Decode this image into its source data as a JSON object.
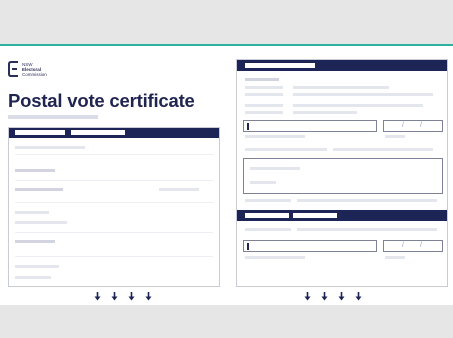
{
  "document": {
    "logo": {
      "lines": [
        "NSW",
        "Electoral",
        "Commission"
      ]
    },
    "title": "Postal vote certificate"
  },
  "colors": {
    "navy": "#1c2555",
    "teal_rule": "#2bb3a0",
    "background": "#e6e6e6"
  },
  "icons": {
    "arrow": "arrow-down-icon"
  }
}
